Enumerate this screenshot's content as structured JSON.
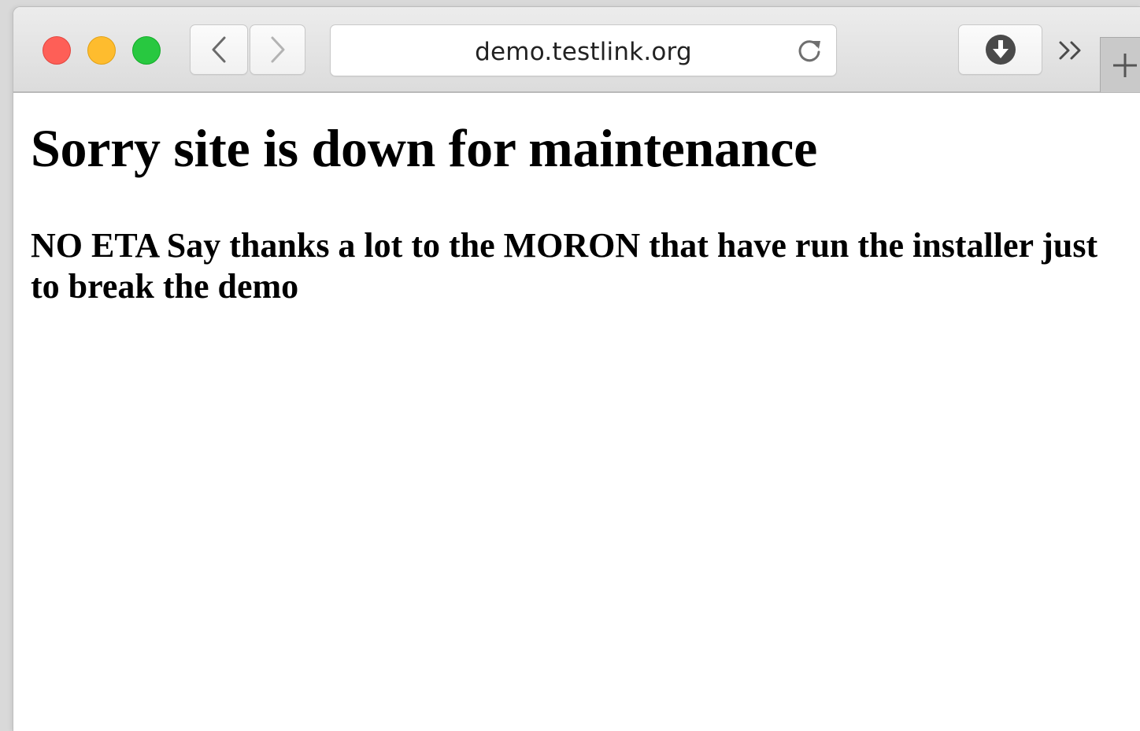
{
  "browser": {
    "address_bar": {
      "url": "demo.testlink.org"
    },
    "icons": {
      "back": "chevron-left-icon",
      "forward": "chevron-right-icon",
      "reload": "reload-icon",
      "download": "download-icon",
      "overflow": "double-chevron-icon",
      "new_tab": "plus-icon"
    }
  },
  "page": {
    "heading": "Sorry site is down for maintenance",
    "message": "NO ETA Say thanks a lot to the MORON that have run the installer just to break the demo"
  }
}
